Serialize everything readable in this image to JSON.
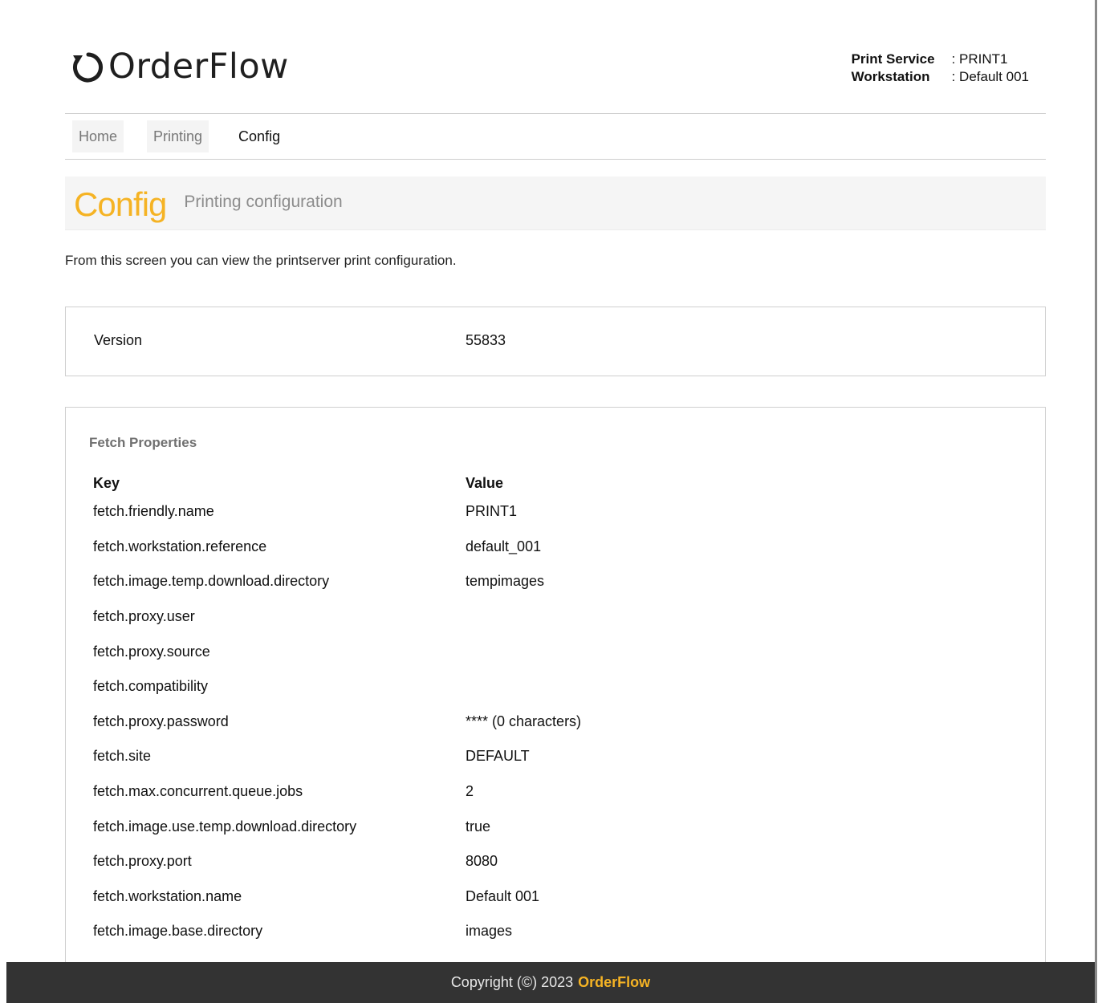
{
  "header": {
    "logo_text": "OrderFlow",
    "service": {
      "print_service_label": "Print Service",
      "print_service_value": ": PRINT1",
      "workstation_label": "Workstation",
      "workstation_value": ": Default 001"
    }
  },
  "nav": {
    "items": [
      {
        "label": "Home",
        "active": false
      },
      {
        "label": "Printing",
        "active": false
      },
      {
        "label": "Config",
        "active": true
      }
    ]
  },
  "page": {
    "title": "Config",
    "subtitle": "Printing configuration",
    "intro": "From this screen you can view the printserver print configuration."
  },
  "version": {
    "key": "Version",
    "value": "55833"
  },
  "fetch": {
    "heading": "Fetch Properties",
    "columns": {
      "key": "Key",
      "value": "Value"
    },
    "rows": [
      {
        "key": "fetch.friendly.name",
        "value": "PRINT1"
      },
      {
        "key": "fetch.workstation.reference",
        "value": "default_001"
      },
      {
        "key": "fetch.image.temp.download.directory",
        "value": "tempimages"
      },
      {
        "key": "fetch.proxy.user",
        "value": ""
      },
      {
        "key": "fetch.proxy.source",
        "value": ""
      },
      {
        "key": "fetch.compatibility",
        "value": ""
      },
      {
        "key": "fetch.proxy.password",
        "value": "**** (0 characters)"
      },
      {
        "key": "fetch.site",
        "value": "DEFAULT"
      },
      {
        "key": "fetch.max.concurrent.queue.jobs",
        "value": "2"
      },
      {
        "key": "fetch.image.use.temp.download.directory",
        "value": "true"
      },
      {
        "key": "fetch.proxy.port",
        "value": "8080"
      },
      {
        "key": "fetch.workstation.name",
        "value": "Default 001"
      },
      {
        "key": "fetch.image.base.directory",
        "value": "images"
      }
    ]
  },
  "footer": {
    "copyright": "Copyright (©) 2023",
    "brand": "OrderFlow"
  },
  "colors": {
    "accent": "#f5b324",
    "footer_bg": "#333333"
  }
}
